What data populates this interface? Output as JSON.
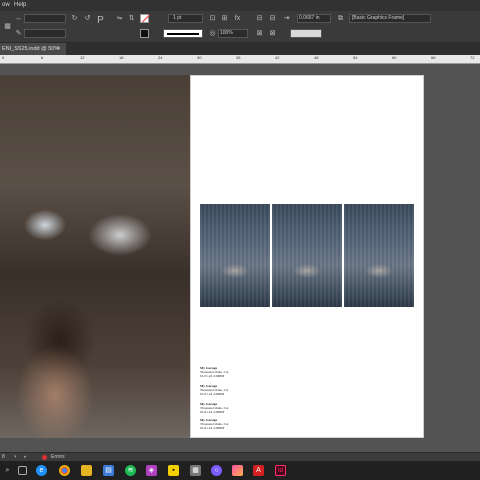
{
  "menu": {
    "window_partial": "ow",
    "help": "Help"
  },
  "control_bar": {
    "stroke_weight": "1 pt",
    "opacity": "100%",
    "offset_value": "0.0667 in",
    "frame_style": "[Basic Graphics Frame]"
  },
  "document_tab": {
    "label": "ENI_SS25.indd @ 50%",
    "close": "×"
  },
  "ruler": {
    "labels": [
      "0",
      "6",
      "12",
      "18",
      "24",
      "30",
      "36",
      "42",
      "48",
      "54",
      "60",
      "66",
      "72"
    ]
  },
  "captions": [
    {
      "title": "My Garage",
      "line1": "Thousand Oaks, CA",
      "line2": "01.01.24 4:06PM"
    },
    {
      "title": "My Garage",
      "line1": "Thousand Oaks, CA",
      "line2": "01.01.24 4:06PM"
    },
    {
      "title": "My Garage",
      "line1": "Thousand Oaks, CA",
      "line2": "01.01.24 4:06PM"
    },
    {
      "title": "My Garage",
      "line1": "Thousand Oaks, CA",
      "line2": "01.01.24 4:06PM"
    }
  ],
  "status": {
    "page": "8",
    "status_text": "Errors"
  },
  "colors": {
    "app_bg": "#535353",
    "panel": "#3a3a3a",
    "indesign": "#ff3366",
    "error": "#e03030"
  }
}
